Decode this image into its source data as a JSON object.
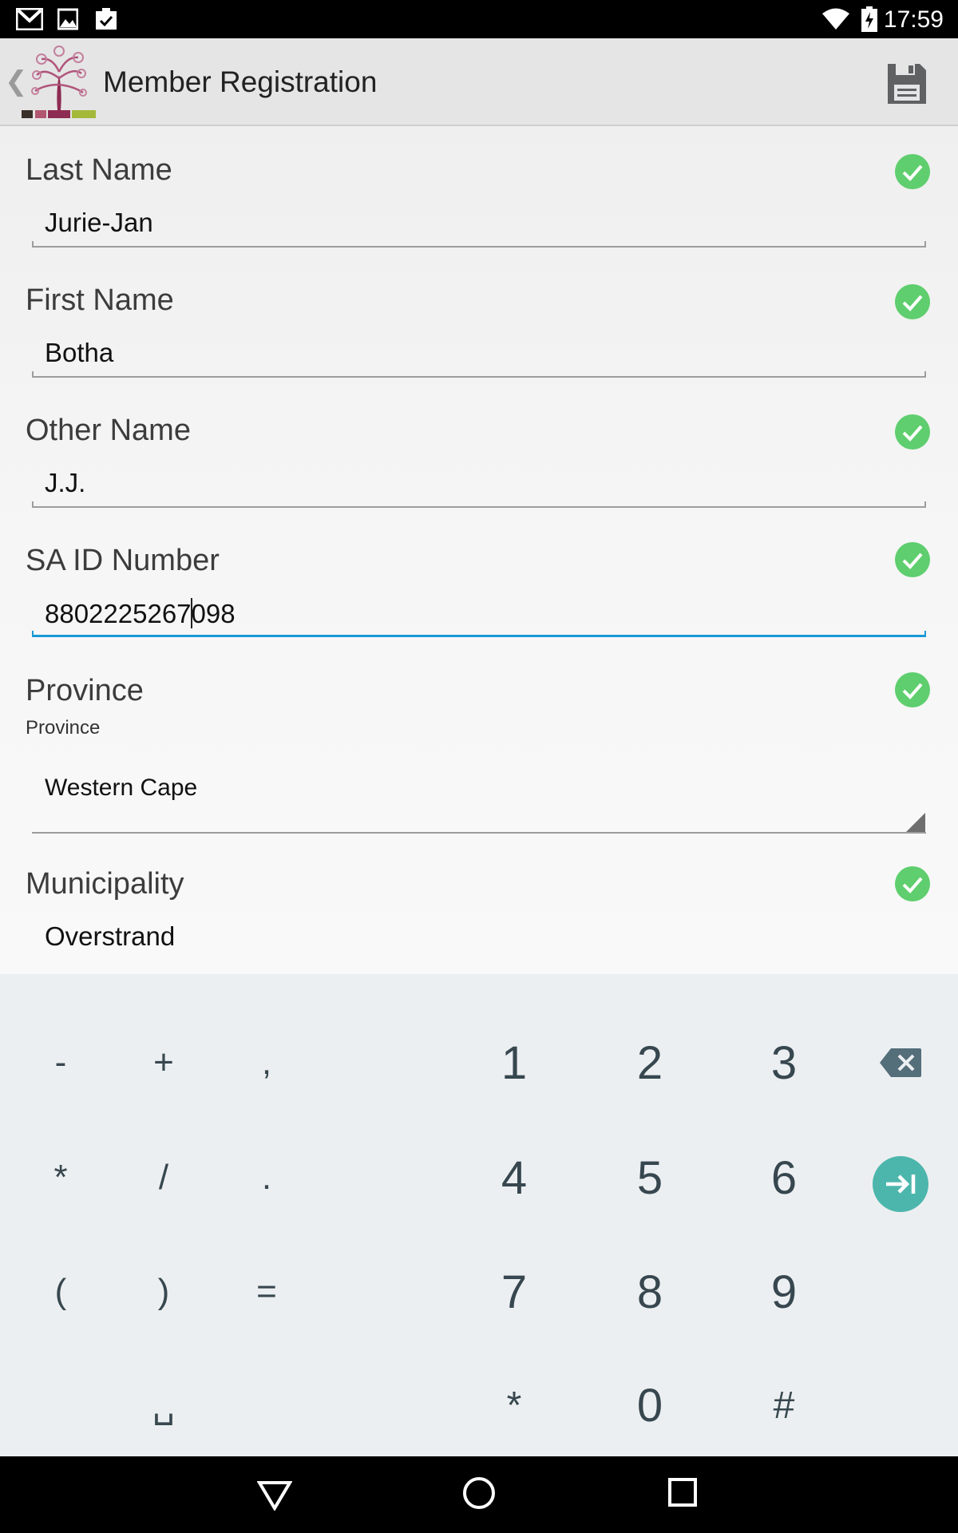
{
  "status_bar": {
    "time": "17:59",
    "left_icons": [
      "gmail-icon",
      "gallery-icon",
      "clipboard-check-icon"
    ],
    "right_icons": [
      "wifi-icon",
      "battery-charging-icon"
    ]
  },
  "action_bar": {
    "title": "Member Registration",
    "back_icon": "chevron-left-icon",
    "logo": "tree-logo-icon",
    "save_icon": "floppy-save-icon"
  },
  "form": {
    "fields": [
      {
        "label": "Last Name",
        "value": "Jurie-Jan",
        "valid": true
      },
      {
        "label": "First Name",
        "value": "Botha",
        "valid": true
      },
      {
        "label": "Other Name",
        "value": "J.J.",
        "valid": true
      },
      {
        "label": "SA ID Number",
        "value_before_cursor": "8802225267",
        "value_after_cursor": "098",
        "valid": true,
        "focused": true
      },
      {
        "label": "Province",
        "sublabel": "Province",
        "value": "Western Cape",
        "valid": true,
        "type": "dropdown"
      },
      {
        "label": "Municipality",
        "value": "Overstrand",
        "valid": true
      }
    ]
  },
  "keyboard": {
    "rows": [
      {
        "symbols": [
          "-",
          "+",
          ","
        ],
        "digits": [
          "1",
          "2",
          "3"
        ]
      },
      {
        "symbols": [
          "*",
          "/",
          "."
        ],
        "digits": [
          "4",
          "5",
          "6"
        ]
      },
      {
        "symbols": [
          "(",
          ")",
          "="
        ],
        "digits": [
          "7",
          "8",
          "9"
        ]
      },
      {
        "symbols": [
          "␣"
        ],
        "digits": [
          "*",
          "0",
          "#"
        ]
      }
    ],
    "backspace_icon": "backspace-icon",
    "next_icon": "next-field-icon",
    "accent_color": "#4db6ac"
  },
  "nav_bar": {
    "icons": [
      "back-triangle-icon",
      "home-circle-icon",
      "recents-square-icon"
    ]
  },
  "colors": {
    "check_green": "#5fce6e",
    "focus_blue": "#1a9ad6"
  }
}
